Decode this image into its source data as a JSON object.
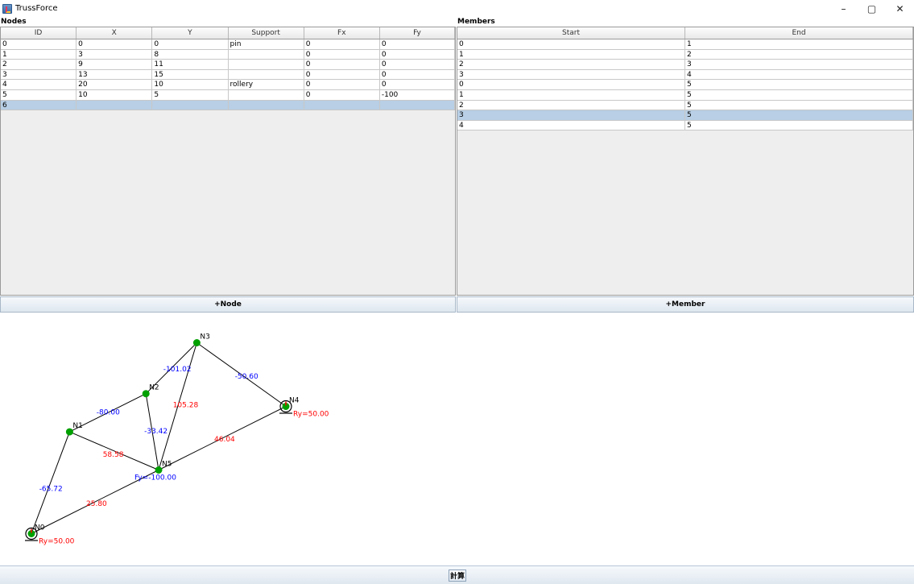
{
  "window": {
    "title": "TrussForce",
    "minimize_glyph": "–",
    "maximize_glyph": "▢",
    "close_glyph": "✕"
  },
  "nodes_panel": {
    "label": "Nodes",
    "headers": [
      "ID",
      "X",
      "Y",
      "Support",
      "Fx",
      "Fy"
    ],
    "rows": [
      [
        "0",
        "0",
        "0",
        "pin",
        "0",
        "0"
      ],
      [
        "1",
        "3",
        "8",
        "",
        "0",
        "0"
      ],
      [
        "2",
        "9",
        "11",
        "",
        "0",
        "0"
      ],
      [
        "3",
        "13",
        "15",
        "",
        "0",
        "0"
      ],
      [
        "4",
        "20",
        "10",
        "rollery",
        "0",
        "0"
      ],
      [
        "5",
        "10",
        "5",
        "",
        "0",
        "-100"
      ],
      [
        "6",
        "",
        "",
        "",
        "",
        ""
      ]
    ],
    "selected_row": 6,
    "add_button": "+Node"
  },
  "members_panel": {
    "label": "Members",
    "headers": [
      "Start",
      "End"
    ],
    "rows": [
      [
        "0",
        "1"
      ],
      [
        "1",
        "2"
      ],
      [
        "2",
        "3"
      ],
      [
        "3",
        "4"
      ],
      [
        "0",
        "5"
      ],
      [
        "1",
        "5"
      ],
      [
        "2",
        "5"
      ],
      [
        "3",
        "5"
      ],
      [
        "4",
        "5"
      ]
    ],
    "selected_row": 7,
    "add_button": "+Member"
  },
  "truss_view": {
    "node_labels": [
      "N0",
      "N1",
      "N2",
      "N3",
      "N4",
      "N5"
    ],
    "member_forces": [
      {
        "start": 0,
        "end": 1,
        "label": "-65.72",
        "kind": "compression"
      },
      {
        "start": 1,
        "end": 2,
        "label": "-80.00",
        "kind": "compression"
      },
      {
        "start": 2,
        "end": 3,
        "label": "-101.02",
        "kind": "compression"
      },
      {
        "start": 3,
        "end": 4,
        "label": "-50.60",
        "kind": "compression"
      },
      {
        "start": 0,
        "end": 5,
        "label": "25.80",
        "kind": "tension"
      },
      {
        "start": 1,
        "end": 5,
        "label": "58.58",
        "kind": "tension"
      },
      {
        "start": 2,
        "end": 5,
        "label": "-33.42",
        "kind": "compression"
      },
      {
        "start": 3,
        "end": 5,
        "label": "105.28",
        "kind": "tension"
      },
      {
        "start": 4,
        "end": 5,
        "label": "46.04",
        "kind": "tension"
      }
    ],
    "reactions": [
      {
        "node": 0,
        "label": "Ry=50.00"
      },
      {
        "node": 4,
        "label": "Ry=50.00"
      }
    ],
    "load": {
      "node": 5,
      "label": "Fy=-100.00"
    },
    "colors": {
      "compression": "#0000ff",
      "tension": "#ff0000",
      "node": "#00a000",
      "member": "#000000"
    }
  },
  "calc_button": "計算"
}
